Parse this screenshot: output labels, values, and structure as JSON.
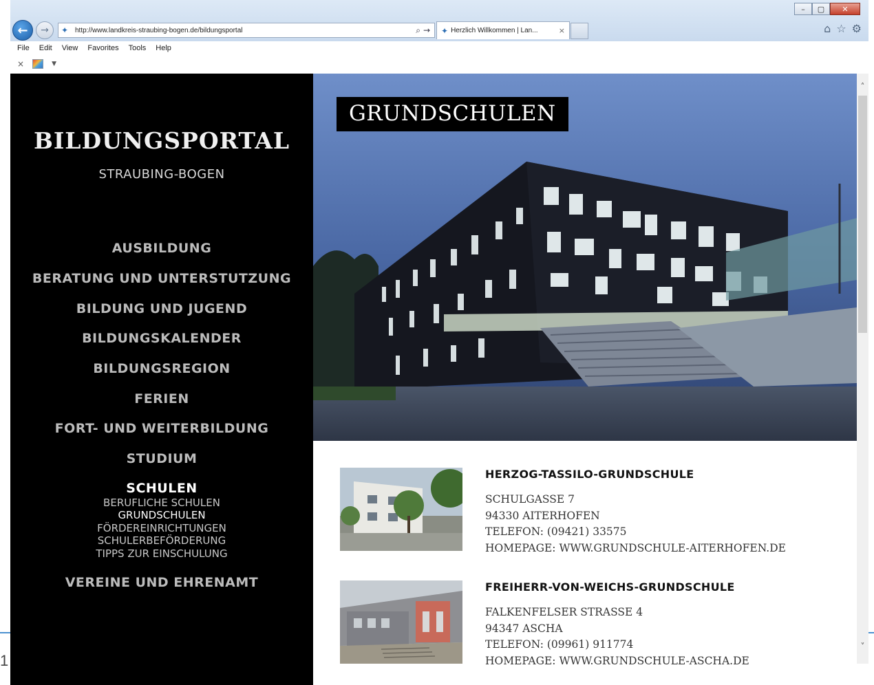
{
  "browser": {
    "url": "http://www.landkreis-straubing-bogen.de/bildungsportal",
    "tab_title": "Herzlich Willkommen | Lan...",
    "tab_close": "×",
    "menu": [
      "File",
      "Edit",
      "View",
      "Favorites",
      "Tools",
      "Help"
    ],
    "cmd_close": "×",
    "window_buttons": {
      "minimize": "–",
      "maximize": "▢",
      "close": "✕"
    },
    "icons": {
      "back": "←",
      "forward": "→",
      "search": "⌕",
      "refresh": "→",
      "home": "⌂",
      "favorites": "☆",
      "settings": "⚙"
    }
  },
  "sidebar": {
    "title": "BILDUNGSPORTAL",
    "subtitle": "STRAUBING-BOGEN",
    "nav": [
      "AUSBILDUNG",
      "BERATUNG UND UNTERSTUTZUNG",
      "BILDUNG UND JUGEND",
      "BILDUNGSKALENDER",
      "BILDUNGSREGION",
      "FERIEN",
      "FORT- UND WEITERBILDUNG",
      "STUDIUM",
      "SCHULEN",
      "VEREINE UND EHRENAMT"
    ],
    "subnav": [
      "BERUFLICHE SCHULEN",
      "GRUNDSCHULEN",
      "FÖRDEREINRICHTUNGEN",
      "SCHULERBEFÖRDERUNG",
      "TIPPS ZUR EINSCHULUNG"
    ]
  },
  "hero": {
    "label": "GRUNDSCHULEN"
  },
  "schools": [
    {
      "name": "HERZOG-TASSILO-GRUNDSCHULE",
      "street": "SCHULGASSE 7",
      "city": "94330 AITERHOFEN",
      "phone": "TELEFON: (09421) 33575",
      "homepage": "HOMEPAGE: WWW.GRUNDSCHULE-AITERHOFEN.DE"
    },
    {
      "name": "FREIHERR-VON-WEICHS-GRUNDSCHULE",
      "street": "FALKENFELSER STRASSE 4",
      "city": "94347 ASCHA",
      "phone": "TELEFON: (09961) 911774",
      "homepage": "HOMEPAGE: WWW.GRUNDSCHULE-ASCHA.DE"
    }
  ],
  "scrollbar": {
    "up": "˄",
    "down": "˅"
  },
  "slide_number": "1",
  "colors": {
    "sidebar_bg": "#000000",
    "accent_line": "#4a90d0"
  }
}
